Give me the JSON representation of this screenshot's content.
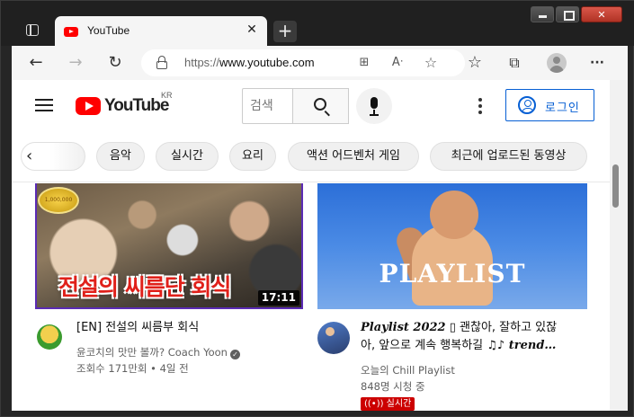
{
  "browser": {
    "tab": {
      "title": "YouTube",
      "close_glyph": "✕"
    },
    "new_tab_glyph": "+",
    "toolbar": {
      "back_glyph": "←",
      "forward_glyph": "→",
      "refresh_glyph": "↻",
      "url_scheme": "https://",
      "url_host": "www.youtube.com",
      "addr_icons": [
        "⊞",
        "Aᐧ",
        "☆"
      ],
      "favorites_glyph": "☆",
      "collections_glyph": "⧉",
      "menu_glyph": "···"
    }
  },
  "youtube": {
    "logo_text": "YouTube",
    "region": "KR",
    "search_placeholder": "검색",
    "signin_label": "로그인",
    "chips_prev_glyph": "‹",
    "chips": [
      "음악",
      "실시간",
      "요리",
      "액션 어드벤처 게임",
      "최근에 업로드된 동영상"
    ],
    "videos": [
      {
        "thumb_text": "전설의 씨름단 회식",
        "duration": "17:11",
        "title": "[EN] 전설의 씨름부 회식",
        "channel": "윤코치의 맛만 볼까? Coach Yoon",
        "verified_glyph": "✓",
        "stats": "조회수 171만회 • 4일 전"
      },
      {
        "thumb_text": "PLAYLIST",
        "title_line1_em": "Playlist 2022",
        "title_line1_rest": " ▯ 괜찮아, 잘하고 있잖",
        "title_line2": "아, 앞으로 계속 행복하길 ♫♪",
        "title_line2_em": " trend…",
        "channel": "오늘의 Chill Playlist",
        "stats": "848명 시청 중",
        "live_badge": "((•)) 실시간"
      }
    ]
  }
}
